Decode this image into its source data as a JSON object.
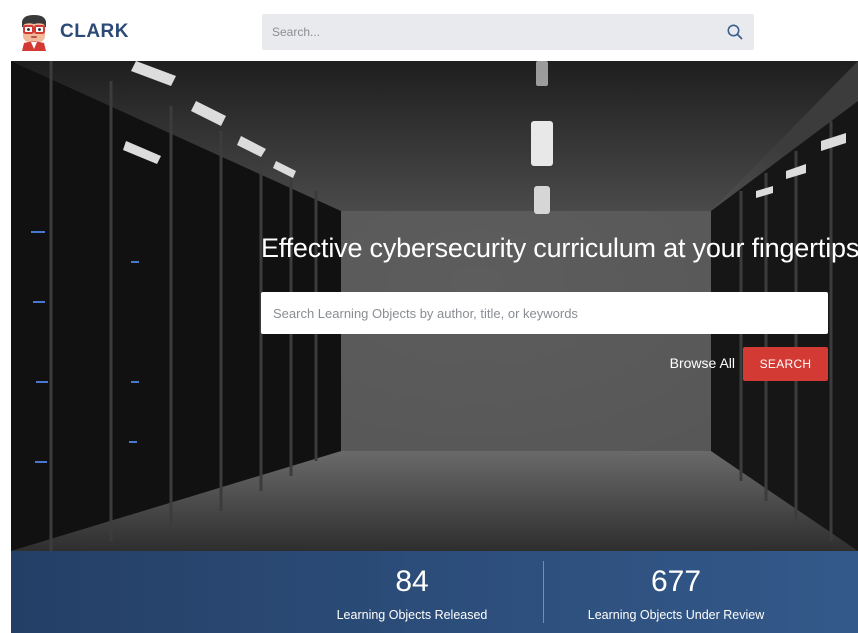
{
  "brand": {
    "name": "CLARK",
    "color": "#2c4a78"
  },
  "header": {
    "search_placeholder": "Search..."
  },
  "hero": {
    "title": "Effective cybersecurity curriculum at your fingertips",
    "search_placeholder": "Search Learning Objects by author, title, or keywords",
    "browse_all_label": "Browse All",
    "search_button_label": "SEARCH",
    "search_button_color": "#d33a34"
  },
  "stats": [
    {
      "value": "84",
      "label": "Learning Objects Released"
    },
    {
      "value": "677",
      "label": "Learning Objects Under Review"
    }
  ],
  "icons": {
    "logo": "mascot-logo-icon",
    "search": "search-icon"
  }
}
